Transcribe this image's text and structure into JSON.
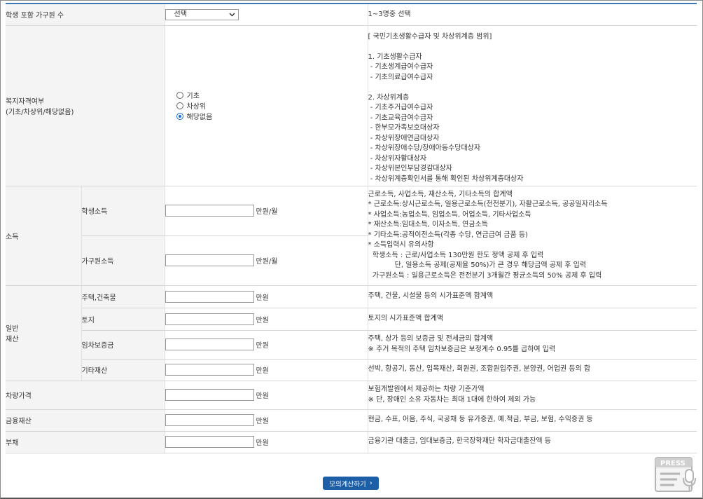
{
  "rows": {
    "household": {
      "label": "학생 포함 가구원 수",
      "select_value": "선택",
      "desc": "1~3명중 선택"
    },
    "welfare": {
      "label_line1": "복지자격여부",
      "label_line2": "(기초/차상위/해당없음)",
      "options": [
        "기초",
        "차상위",
        "해당없음"
      ],
      "selected": "해당없음",
      "desc": [
        "[ 국민기초생활수급자 및 차상위계층 범위]",
        "",
        "1. 기초생활수급자",
        " - 기초생계급여수급자",
        " - 기초의료급여수급자",
        "",
        "2. 차상위계층",
        " - 기초주거급여수급자",
        " - 기초교육급여수급자",
        " - 한부모가족보호대상자",
        " - 차상위장애연금대상자",
        " - 차상위장애수당/장애아동수당대상자",
        " - 차상위자활대상자",
        " - 차상위본인부담경감대상자",
        " - 차상위계층확인서를 통해 확인된 차상위계층대상자"
      ]
    },
    "income": {
      "label": "소득",
      "student_label": "학생소득",
      "household_label": "가구원소득",
      "unit": "만원/월",
      "desc": [
        "근로소득, 사업소득, 재산소득, 기타소득의 합계액",
        "* 근로소득:상시근로소득, 일용근로소득(전전분기), 자활근로소득, 공공일자리소득",
        "* 사업소득:농업소득, 임업소득, 어업소득, 기타사업소득",
        "* 재산소득:임대소득, 이자소득, 연금소득",
        "* 기타소득:공적이전소득(각종 수당, 연금급여 금품 등)",
        "* 소득입력시 유의사항",
        "  학생소득 : 근로/사업소득 130만원 한도 정액 공제 후 입력",
        "            단, 일용소득 공제(공제율 50%)가 큰 경우 해당금액 공제 후 입력",
        "  가구원소득 : 일용근로소득은 전전분기 3개월간 평균소득의 50% 공제 후 입력"
      ]
    },
    "property": {
      "label_line1": "일반",
      "label_line2": "재산",
      "unit": "만원",
      "items": [
        {
          "label": "주택,건축물",
          "desc": [
            "주택, 건물, 시설물 등의 시가표준액 합계액"
          ]
        },
        {
          "label": "토지",
          "desc": [
            "토지의 시가표준액 합계액"
          ]
        },
        {
          "label": "임차보증금",
          "desc": [
            "주택, 상가 등의 보증금 및 전세금의 합계액",
            "※ 주거 목적의 주택 임차보증금은 보정계수 0.95를 곱하여 입력"
          ]
        },
        {
          "label": "기타재산",
          "desc": [
            "선박, 항공기, 동산, 입목재산, 회원권, 조합원입주권, 분양권, 어업권 등의 합"
          ]
        }
      ]
    },
    "vehicle": {
      "label": "차량가격",
      "unit": "만원",
      "desc": [
        "보험개발원에서 제공하는 차량 기준가액",
        "※ 단, 장애인 소유 자동차는 최대 1대에 한하여 제외 가능"
      ]
    },
    "finance": {
      "label": "금융재산",
      "unit": "만원",
      "desc": "현금, 수표, 어음, 주식, 국공채 등 유가증권, 예.적금, 부금, 보험, 수익증권 등"
    },
    "debt": {
      "label": "부채",
      "unit": "만원",
      "desc": "금융기관 대출금, 임대보증금, 한국장학재단 학자금대출잔액 등"
    }
  },
  "button": {
    "label": "모의계산하기",
    "arrow": "›"
  },
  "watermark": {
    "text": "PRESS",
    "icon": "press-microphone-icon"
  },
  "colors": {
    "accent": "#3d78b4",
    "button": "#1d5fa6",
    "radio": "#1a6fd8"
  }
}
